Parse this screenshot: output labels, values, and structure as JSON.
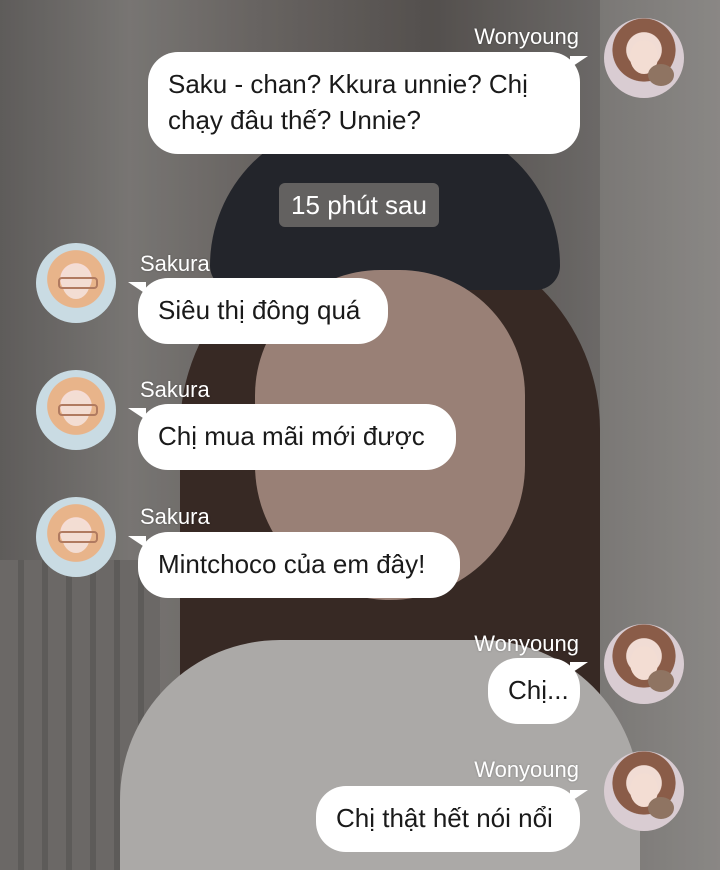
{
  "messages": [
    {
      "sender": "Wonyoung",
      "text": "Saku - chan? Kkura unnie? Chị chạy đâu thế? Unnie?"
    },
    {
      "sender": "Sakura",
      "text": "Siêu thị đông quá"
    },
    {
      "sender": "Sakura",
      "text": "Chị mua mãi mới được"
    },
    {
      "sender": "Sakura",
      "text": "Mintchoco của em đây!"
    },
    {
      "sender": "Wonyoung",
      "text": "Chị..."
    },
    {
      "sender": "Wonyoung",
      "text": "Chị thật hết nói nổi"
    }
  ],
  "separator": "15 phút sau",
  "colors": {
    "bubble": "#ffffff",
    "name_text": "#ffffff",
    "separator_bg": "#6e6c6a"
  }
}
